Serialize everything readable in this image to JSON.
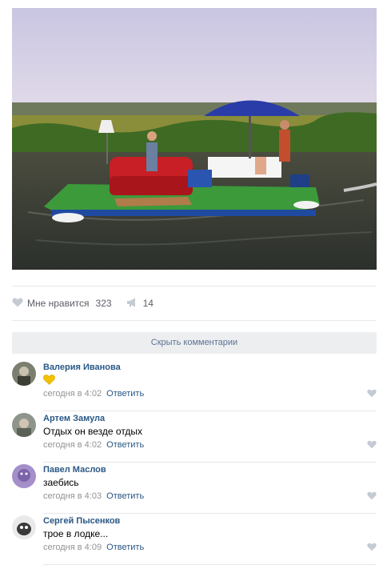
{
  "post": {
    "likes_label": "Мне нравится",
    "likes_count": "323",
    "shares_count": "14"
  },
  "comments_toggle": "Скрыть комментарии",
  "comments": [
    {
      "author": "Валерия Иванова",
      "text": "💛",
      "time": "сегодня в 4:02",
      "reply": "Ответить"
    },
    {
      "author": "Артем Замула",
      "text": "Отдых он везде отдых",
      "time": "сегодня в 4:02",
      "reply": "Ответить"
    },
    {
      "author": "Павел Маслов",
      "text": "заебись",
      "time": "сегодня в 4:03",
      "reply": "Ответить"
    },
    {
      "author": "Сергей Пысенков",
      "text": "трое в лодке...",
      "time": "сегодня в 4:09",
      "reply": "Ответить"
    }
  ],
  "colors": {
    "link": "#2a5885",
    "muted": "#939393",
    "button_bg": "#edeef0",
    "button_text": "#5b7394",
    "heart_emoji": "#f2c200"
  },
  "icons": [
    "heart-icon",
    "megaphone-icon",
    "small-heart-icon"
  ]
}
